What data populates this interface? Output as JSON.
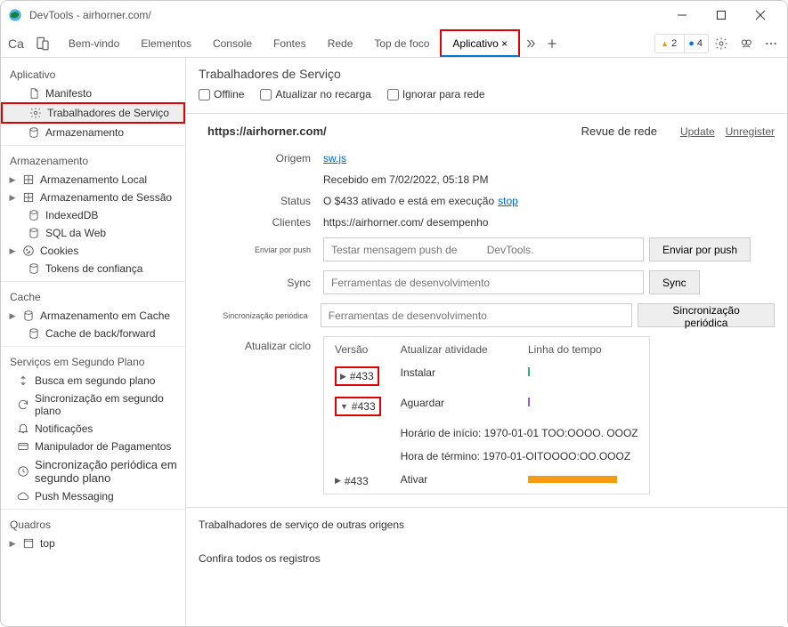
{
  "title": "DevTools - airhorner.com/",
  "tabs_left": "Ca",
  "tabs": {
    "welcome": "Bem-vindo",
    "elements": "Elementos",
    "console": "Console",
    "sources": "Fontes",
    "network": "Rede",
    "topfocus": "Top de foco",
    "application": "Aplicativo ×"
  },
  "badges": {
    "warnings": "2",
    "info": "4"
  },
  "sidebar": {
    "app_header": "Aplicativo",
    "app_items": {
      "manifest": "Manifesto",
      "sw": "Trabalhadores de Serviço",
      "storage": "Armazenamento"
    },
    "storage_header": "Armazenamento",
    "storage_items": {
      "local": "Armazenamento Local",
      "session": "Armazenamento de Sessão",
      "indexeddb": "IndexedDB",
      "websql": "SQL da Web",
      "cookies": "Cookies",
      "trusttokens": "Tokens de confiança"
    },
    "cache_header": "Cache",
    "cache_items": {
      "cachestorage": "Armazenamento em Cache",
      "bfcache": "Cache de back/forward"
    },
    "bg_header": "Serviços em Segundo Plano",
    "bg_items": {
      "bgfetch": "Busca em segundo plano",
      "bgsync": "Sincronização em segundo plano",
      "notifications": "Notificações",
      "payments": "Manipulador de Pagamentos",
      "periodicsync": "Sincronização periódica em segundo plano",
      "pushmsg": "Push Messaging"
    },
    "frames_header": "Quadros",
    "frames_items": {
      "top": "top"
    }
  },
  "content": {
    "heading": "Trabalhadores de Serviço",
    "checks": {
      "offline": "Offline",
      "update_reload": "Atualizar no recarga",
      "bypass": "Ignorar para rede"
    },
    "origin_url": "https://airhorner.com/",
    "net_review": "Revue de rede",
    "update_link": "Update",
    "unregister_link": "Unregister",
    "rows": {
      "origin_label": "Origem",
      "origin_value": "sw.js",
      "received_line": "Recebido em 7/02/2022, 05:18 PM",
      "status_label": "Status",
      "status_text": "O $433 ativado e está em execução",
      "status_stop": "stop",
      "clients_label": "Clientes",
      "clients_text": "https://airhorner.com/ desempenho",
      "push_label": "Enviar por push",
      "push_placeholder": "Testar mensagem push de          DevTools.",
      "push_button": "Enviar por push",
      "sync_label": "Sync",
      "sync_placeholder": "Ferramentas de desenvolvimento",
      "sync_button": "Sync",
      "periodic_label": "Sincronização periódica",
      "periodic_placeholder": "Ferramentas de desenvolvimento",
      "periodic_button": "Sincronização periódica",
      "cycle_label": "Atualizar ciclo"
    },
    "cycle_table": {
      "h_version": "Versão",
      "h_activity": "Atualizar atividade",
      "h_timeline": "Linha do tempo",
      "r1_ver": "#433",
      "r1_act": "Instalar",
      "r2_ver": "#433",
      "r2_act": "Aguardar",
      "start_line": "Horário de início: 1970-01-01 TOO:OOOO. OOOZ",
      "end_line": "Hora de término: 1970-01-OITOOOO:OO.OOOZ",
      "r3_ver": "#433",
      "r3_act": "Ativar"
    },
    "footer1": "Trabalhadores de serviço de outras origens",
    "footer2": "Confira todos os registros"
  }
}
